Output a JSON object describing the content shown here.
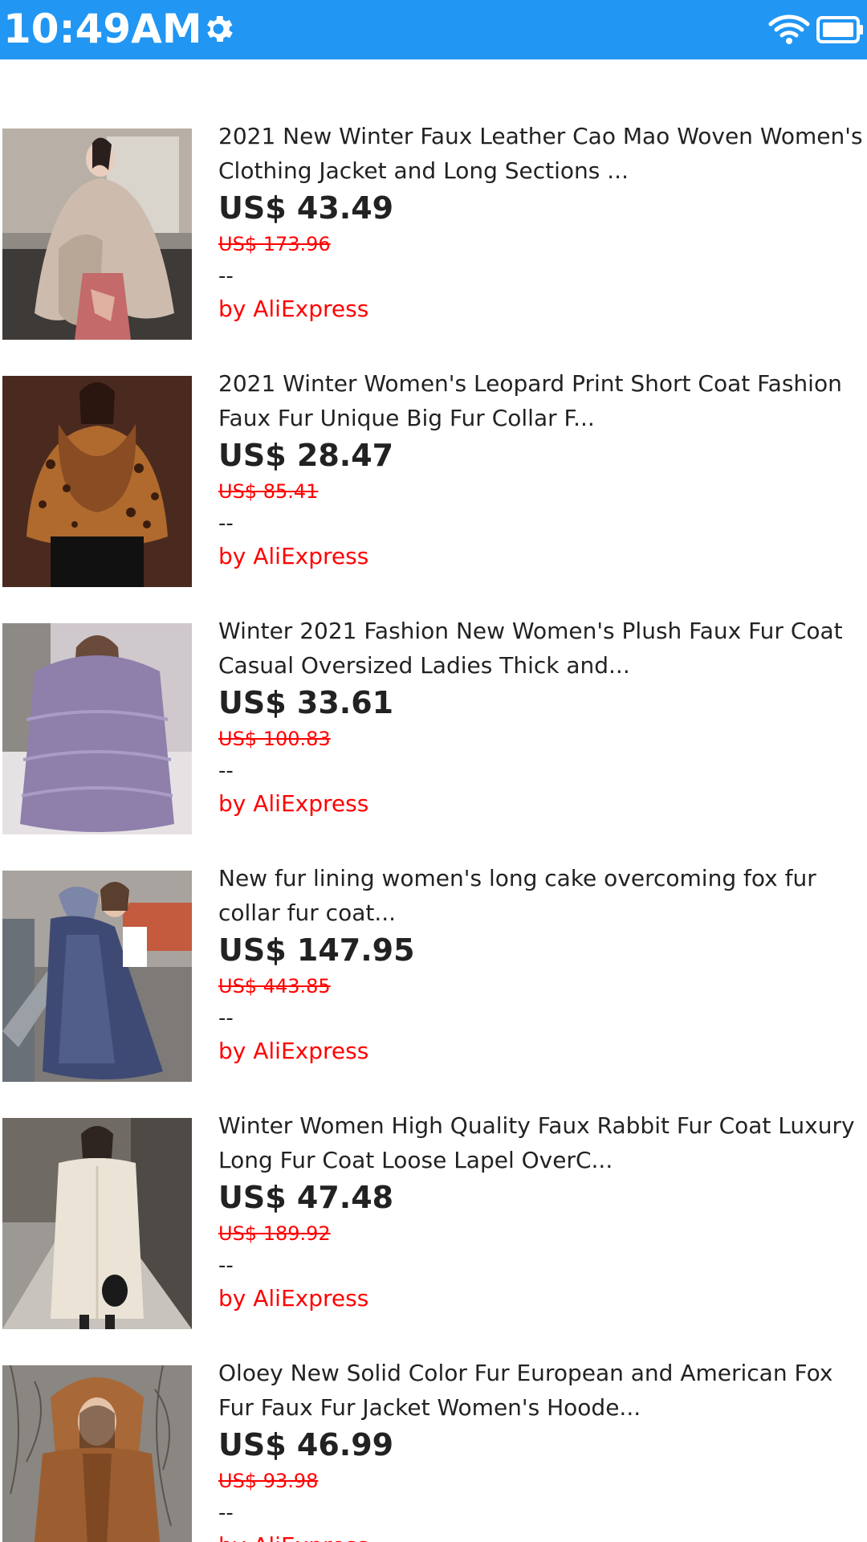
{
  "status_bar": {
    "time": "10:49AM",
    "background": "#2196f3",
    "icons": [
      "gear-icon",
      "wifi-icon",
      "battery-icon"
    ]
  },
  "colors": {
    "price_text": "#222222",
    "original_price": "#ff0000",
    "seller": "#ff0000"
  },
  "products": [
    {
      "title": "2021 New Winter Faux Leather Cao Mao Woven Women's Clothing Jacket and Long Sections ...",
      "price": "US$ 43.49",
      "original_price": "US$ 173.96",
      "rating": "--",
      "seller": "by AliExpress",
      "image": "beige-fur-coat-photo"
    },
    {
      "title": "2021 Winter Women's Leopard Print Short Coat Fashion Faux Fur Unique Big Fur Collar F...",
      "price": "US$ 28.47",
      "original_price": "US$ 85.41",
      "rating": "--",
      "seller": "by AliExpress",
      "image": "leopard-print-coat-photo"
    },
    {
      "title": "Winter 2021 Fashion New Women's Plush Faux Fur Coat Casual Oversized Ladies Thick and...",
      "price": "US$ 33.61",
      "original_price": "US$ 100.83",
      "rating": "--",
      "seller": "by AliExpress",
      "image": "lavender-fur-coat-photo"
    },
    {
      "title": "New fur lining women's long cake overcoming fox fur collar fur coat...",
      "price": "US$ 147.95",
      "original_price": "US$ 443.85",
      "rating": "--",
      "seller": "by AliExpress",
      "image": "navy-hooded-coat-photo"
    },
    {
      "title": "Winter Women High Quality Faux Rabbit Fur Coat Luxury Long Fur Coat Loose Lapel OverC...",
      "price": "US$ 47.48",
      "original_price": "US$ 189.92",
      "rating": "--",
      "seller": "by AliExpress",
      "image": "cream-long-coat-photo"
    },
    {
      "title": "Oloey New Solid Color Fur European and American Fox Fur Faux Fur Jacket Women's Hoode...",
      "price": "US$ 46.99",
      "original_price": "US$ 93.98",
      "rating": "--",
      "seller": "by AliExpress",
      "image": "brown-hooded-coat-photo"
    }
  ]
}
